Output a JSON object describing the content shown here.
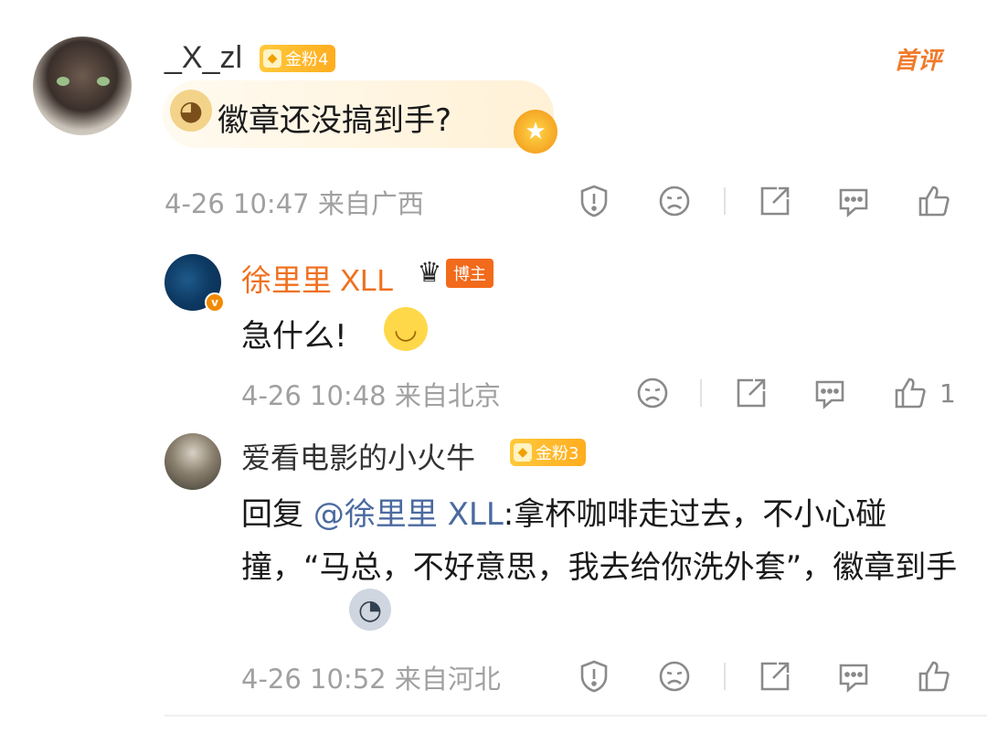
{
  "comments": [
    {
      "username": "_X_zl",
      "badge": "金粉4",
      "first_comment_label": "首评",
      "content": "徽章还没搞到手?",
      "meta": "4-26 10:47 来自广西"
    },
    {
      "username": "徐里里 XLL",
      "badge": "博主",
      "content": "急什么!",
      "meta": "4-26 10:48 来自北京",
      "like_count": "1"
    },
    {
      "username": "爱看电影的小火牛",
      "badge": "金粉3",
      "reply_prefix": "回复 ",
      "mention": "@徐里里 XLL",
      "content": ":拿杯咖啡走过去，不小心碰撞，“马总，不好意思，我去给你洗外套”，徽章到手",
      "meta": "4-26 10:52 来自河北"
    }
  ],
  "icons": {
    "report": "exclamation-shield-icon",
    "dislike": "frown-face-icon",
    "share": "share-icon",
    "comment": "comment-bubble-icon",
    "like": "thumbs-up-icon"
  },
  "colors": {
    "blogger_name": "#f07020",
    "mention": "#4b6aa0",
    "badge_gold": "#ffb52a",
    "blogger_tag": "#f26a1b",
    "meta_gray": "#a0a0a0"
  }
}
